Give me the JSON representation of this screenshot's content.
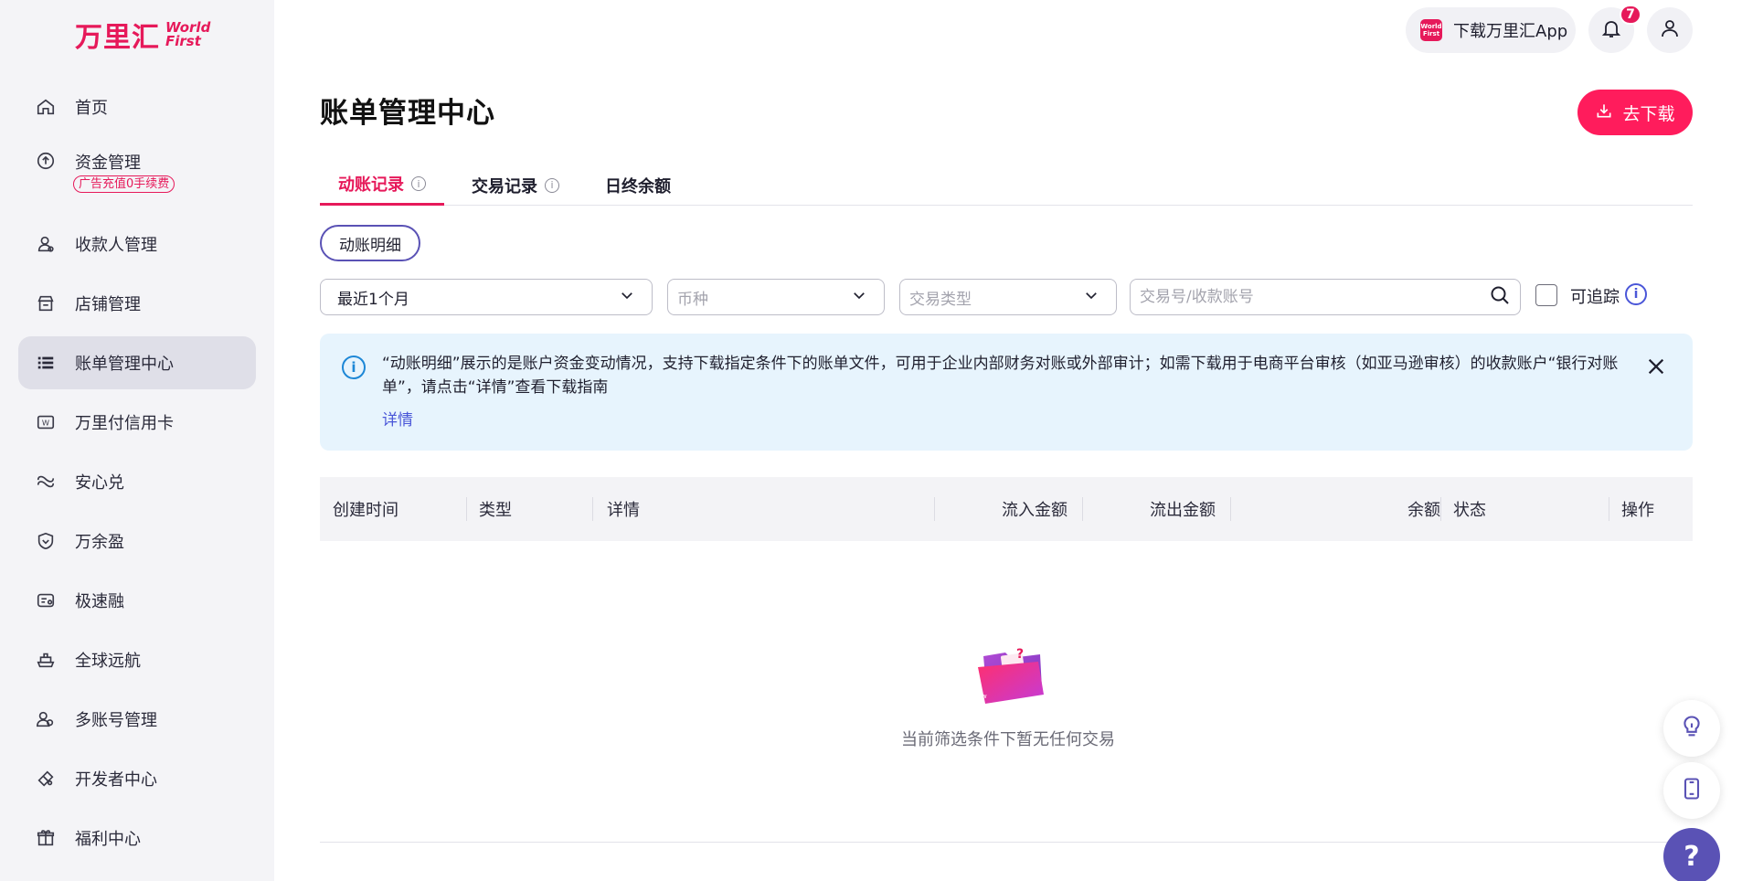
{
  "brand": {
    "logo_cn": "万里汇",
    "logo_en_line1": "World",
    "logo_en_line2": "First"
  },
  "sidebar": {
    "items": [
      {
        "label": "首页",
        "icon": "home-icon"
      },
      {
        "label": "资金管理",
        "icon": "fund-icon",
        "badge": "广告充值0手续费"
      },
      {
        "label": "收款人管理",
        "icon": "payee-icon"
      },
      {
        "label": "店铺管理",
        "icon": "store-icon"
      },
      {
        "label": "账单管理中心",
        "icon": "bill-list-icon",
        "active": true
      },
      {
        "label": "万里付信用卡",
        "icon": "credit-card-icon"
      },
      {
        "label": "安心兑",
        "icon": "exchange-icon"
      },
      {
        "label": "万余盈",
        "icon": "shield-yield-icon"
      },
      {
        "label": "极速融",
        "icon": "finance-icon"
      },
      {
        "label": "全球远航",
        "icon": "ship-icon"
      },
      {
        "label": "多账号管理",
        "icon": "multi-account-icon"
      },
      {
        "label": "开发者中心",
        "icon": "developer-icon"
      },
      {
        "label": "福利中心",
        "icon": "gift-icon"
      }
    ]
  },
  "header": {
    "app_download": "下载万里汇App",
    "app_badge_line1": "World",
    "app_badge_line2": "First",
    "notification_count": "7"
  },
  "page": {
    "title": "账单管理中心",
    "download_button": "去下载"
  },
  "tabs": [
    {
      "label": "动账记录",
      "active": true,
      "info": true
    },
    {
      "label": "交易记录",
      "active": false,
      "info": true
    },
    {
      "label": "日终余额",
      "active": false,
      "info": false
    }
  ],
  "chip": "动账明细",
  "filters": {
    "period": "最近1个月",
    "currency_placeholder": "币种",
    "type_placeholder": "交易类型",
    "search_placeholder": "交易号/收款账号",
    "traceable_label": "可追踪"
  },
  "alert": {
    "text": "“动账明细”展示的是账户资金变动情况，支持下载指定条件下的账单文件，可用于企业内部财务对账或外部审计；如需下载用于电商平台审核（如亚马逊审核）的收款账户“银行对账单”，请点击“详情”查看下载指南",
    "link": "详情"
  },
  "table": {
    "columns": [
      "创建时间",
      "类型",
      "详情",
      "流入金额",
      "流出金额",
      "余额",
      "状态",
      "操作"
    ]
  },
  "empty_state": "当前筛选条件下暂无任何交易",
  "colors": {
    "brand": "#e6195a",
    "accent_purple": "#5a52b5",
    "info_blue": "#1d87d6",
    "alert_bg": "#e7f4fd"
  }
}
